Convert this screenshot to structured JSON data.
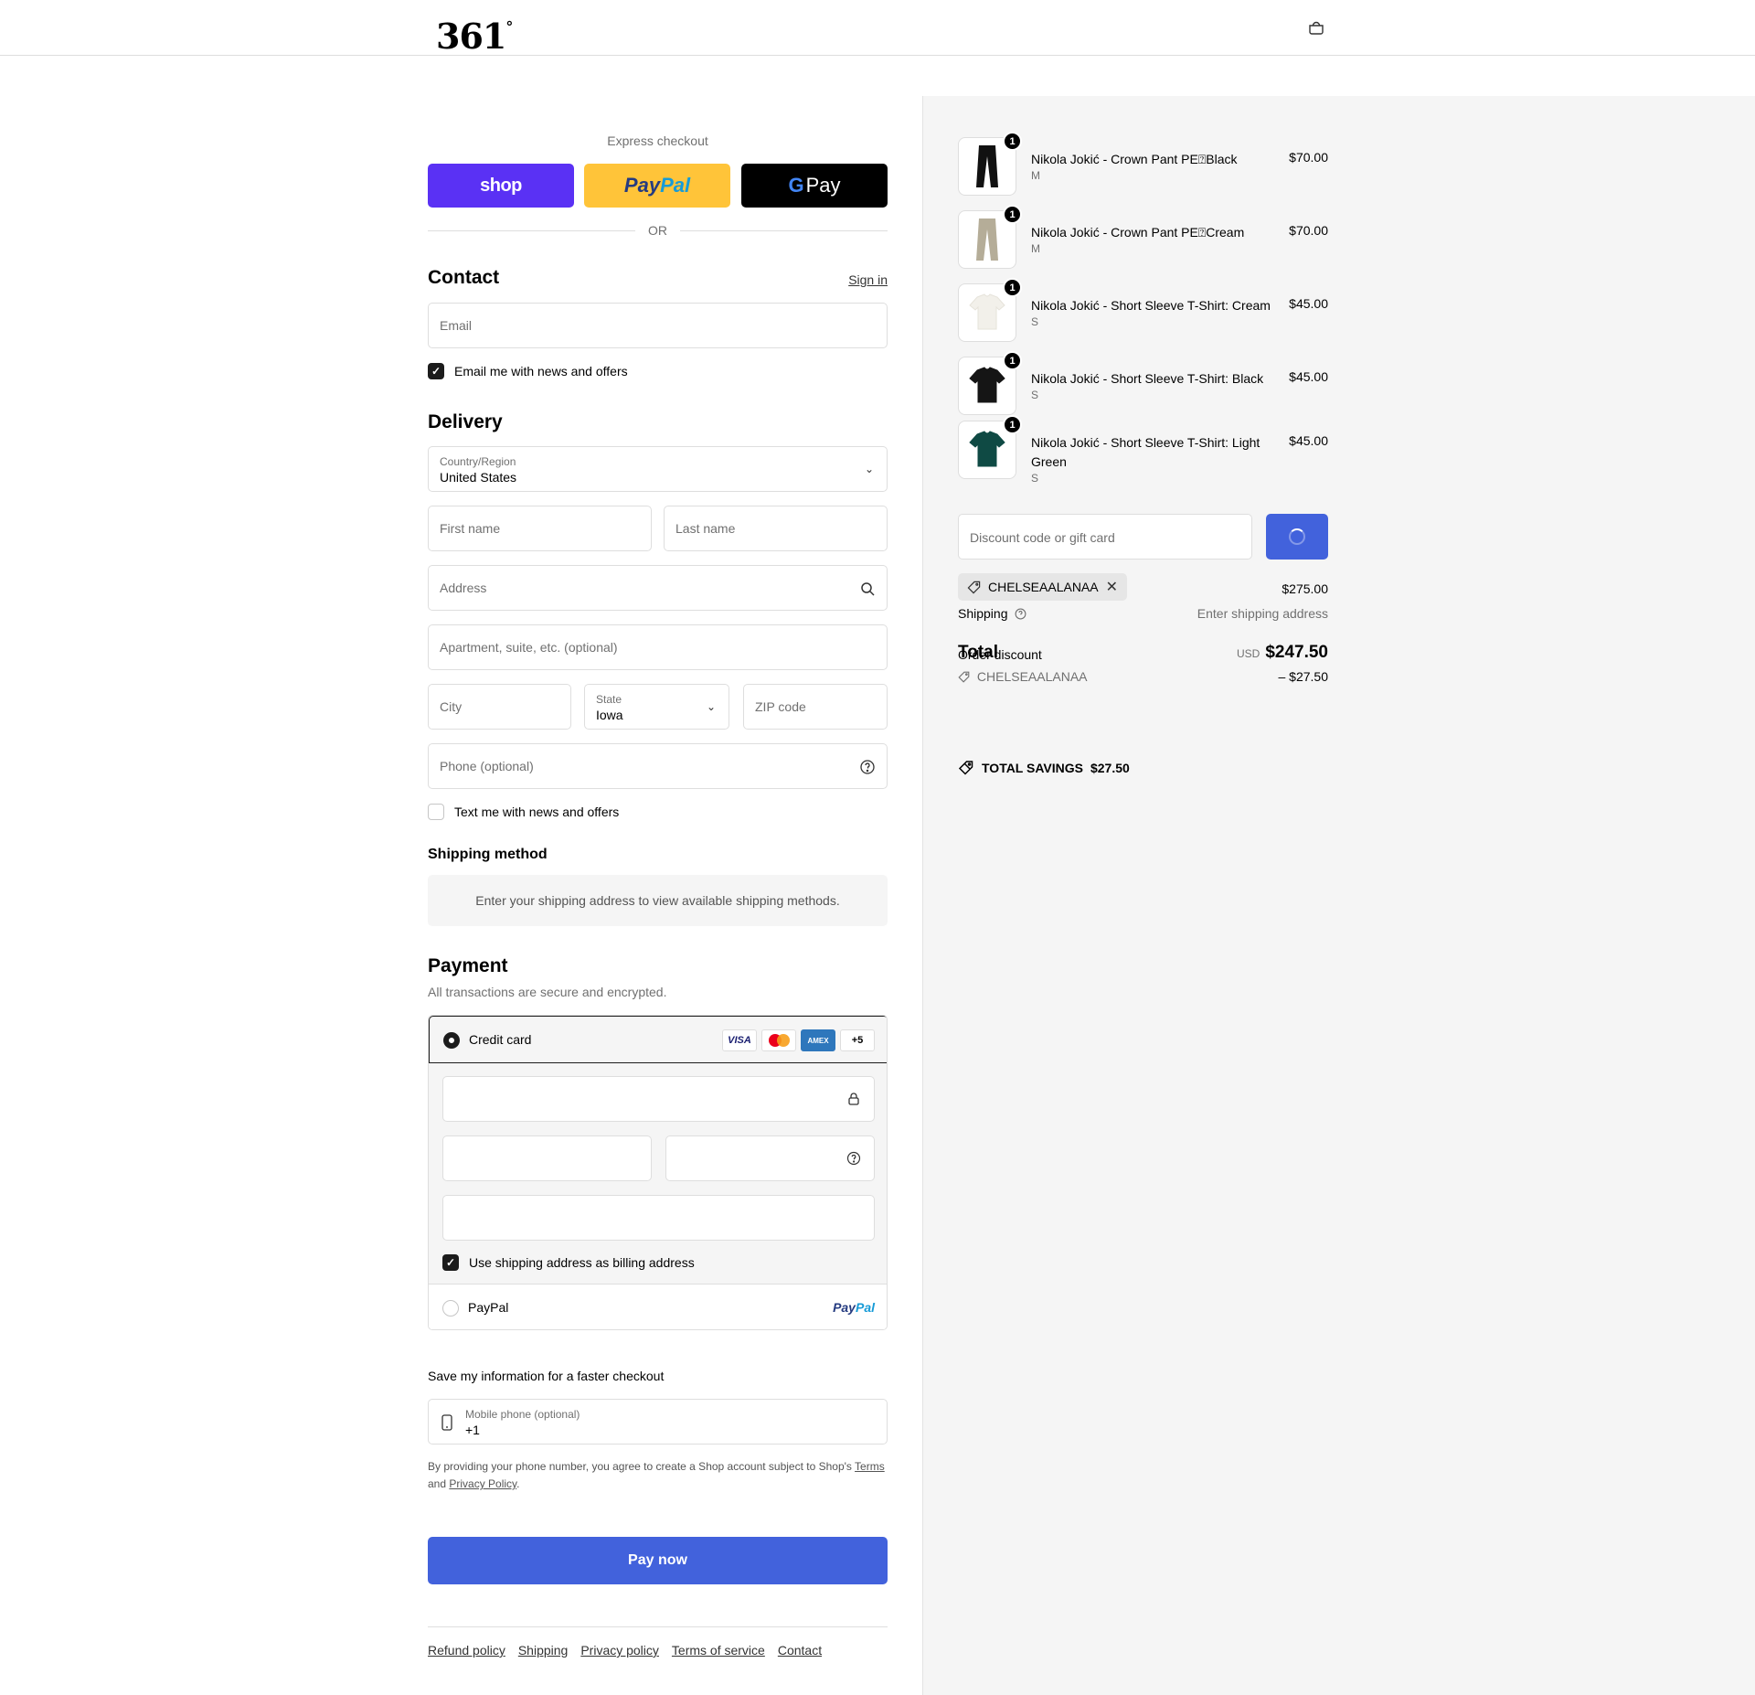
{
  "header": {
    "logo": "361",
    "logo_degree": "°",
    "bag_icon": "bag-icon"
  },
  "express": {
    "title": "Express checkout",
    "shop_label": "shop",
    "paypal_label_a": "Pay",
    "paypal_label_b": "Pal",
    "gpay_g": "G",
    "gpay_label": "Pay",
    "or_label": "OR"
  },
  "contact": {
    "heading": "Contact",
    "sign_in": "Sign in",
    "email_placeholder": "Email",
    "news_label": "Email me with news and offers",
    "news_checked": true
  },
  "delivery": {
    "heading": "Delivery",
    "country_label": "Country/Region",
    "country_value": "United States",
    "first_name": "First name",
    "last_name": "Last name",
    "address": "Address",
    "apartment": "Apartment, suite, etc. (optional)",
    "city": "City",
    "state_label": "State",
    "state_value": "Iowa",
    "zip": "ZIP code",
    "phone": "Phone (optional)",
    "text_label": "Text me with news and offers",
    "text_checked": false
  },
  "shipping_method": {
    "heading": "Shipping method",
    "note": "Enter your shipping address to view available shipping methods."
  },
  "payment": {
    "heading": "Payment",
    "subtitle": "All transactions are secure and encrypted.",
    "credit_card_label": "Credit card",
    "cards": {
      "visa": "VISA",
      "amex": "AMEX",
      "more": "+5"
    },
    "billing_label": "Use shipping address as billing address",
    "billing_checked": true,
    "paypal_label": "PayPal",
    "paypal_logo_a": "Pay",
    "paypal_logo_b": "Pal"
  },
  "save": {
    "title": "Save my information for a faster checkout",
    "mobile_label": "Mobile phone (optional)",
    "mobile_value": "+1",
    "legal_prefix": "By providing your phone number, you agree to create a Shop account subject to Shop's",
    "legal_terms": "Terms",
    "legal_and": "and",
    "legal_privacy": "Privacy Policy",
    "legal_suffix": "."
  },
  "pay_now": "Pay now",
  "footer": {
    "links": [
      "Refund policy",
      "Shipping",
      "Privacy policy",
      "Terms of service",
      "Contact"
    ]
  },
  "summary": {
    "items": [
      {
        "name": "Nikola Jokić - Crown Pant PE⍰Black",
        "variant": "M",
        "price": "$70.00",
        "qty": "1",
        "color": "#111111",
        "kind": "pant"
      },
      {
        "name": "Nikola Jokić - Crown Pant PE⍰Cream",
        "variant": "M",
        "price": "$70.00",
        "qty": "1",
        "color": "#b5ad98",
        "kind": "pant"
      },
      {
        "name": "Nikola Jokić - Short Sleeve T-Shirt: Cream",
        "variant": "S",
        "price": "$45.00",
        "qty": "1",
        "color": "#f2f0ea",
        "kind": "tee"
      },
      {
        "name": "Nikola Jokić - Short Sleeve T-Shirt: Black",
        "variant": "S",
        "price": "$45.00",
        "qty": "1",
        "color": "#151515",
        "kind": "tee"
      },
      {
        "name": "Nikola Jokić - Short Sleeve T-Shirt: Light Green",
        "variant": "S",
        "price": "$45.00",
        "qty": "1",
        "color": "#0f4a44",
        "kind": "tee"
      }
    ],
    "discount_placeholder": "Discount code or gift card",
    "applied_code": "CHELSEAALANAA",
    "subtotal": "$275.00",
    "shipping_label": "Shipping",
    "shipping_value": "Enter shipping address",
    "total_label": "Total",
    "order_discount_label": "Order discount",
    "currency": "USD",
    "total": "$247.50",
    "discount_code": "CHELSEAALANAA",
    "discount_value": "– $27.50",
    "savings_label": "TOTAL SAVINGS",
    "savings_value": "$27.50"
  }
}
